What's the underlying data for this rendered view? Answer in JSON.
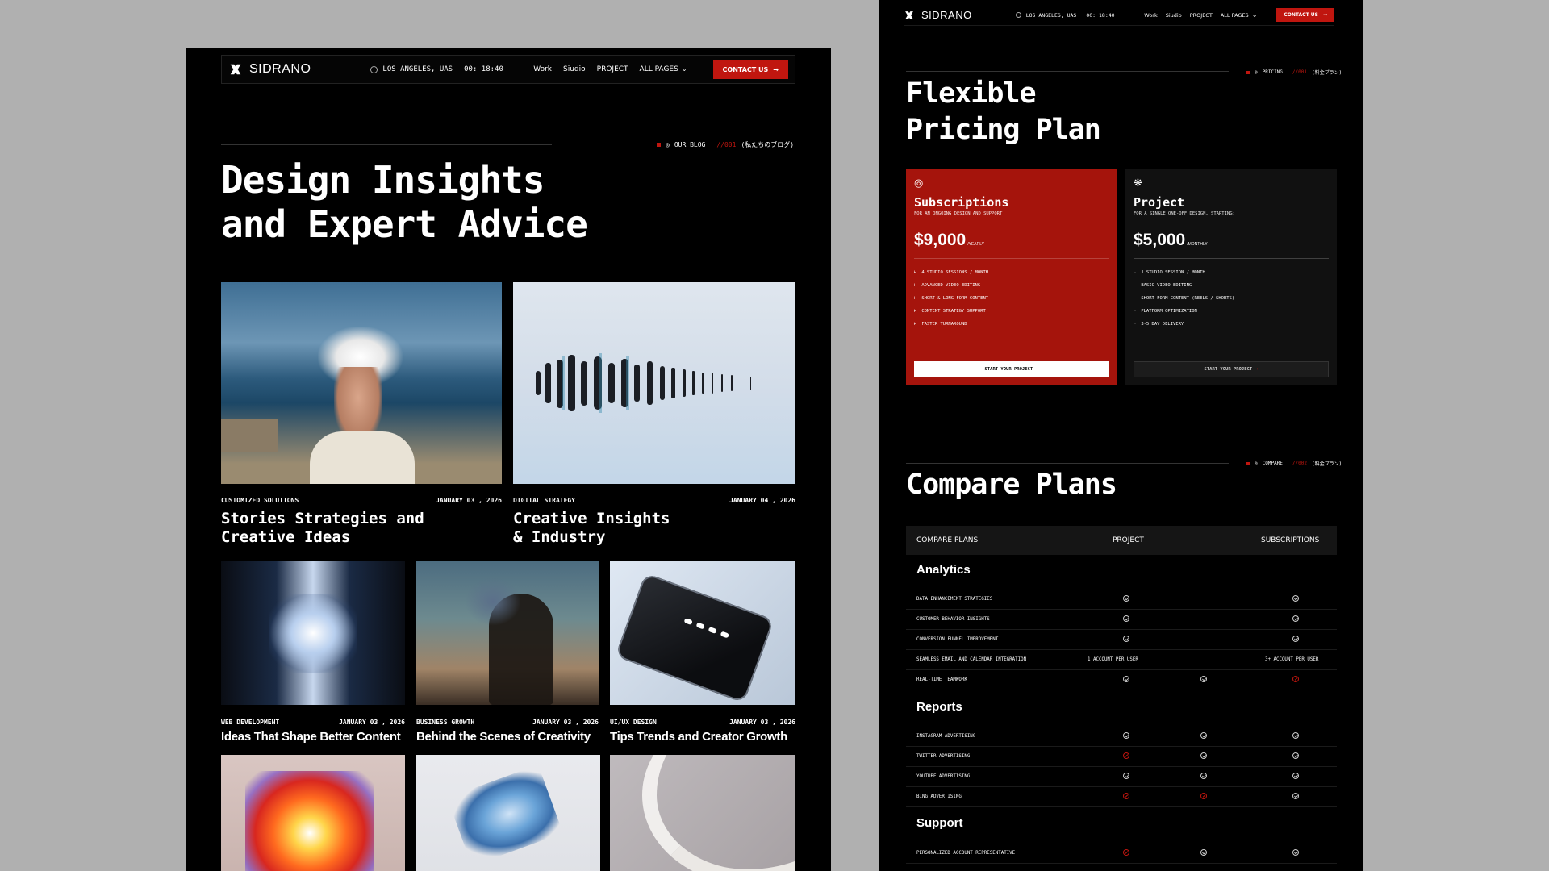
{
  "left": {
    "nav": {
      "brand": "SIDRANO",
      "location": "LOS ANGELES, UAS",
      "time": "00: 18:40",
      "links": [
        "Work",
        "Siudio",
        "PROJECT",
        "ALL PAGES"
      ],
      "cta": "CONTACT US"
    },
    "tag": {
      "label": "OUR BLOG",
      "num": "//001",
      "jp": "(私たちのブログ)"
    },
    "heading_line1": "Design Insights",
    "heading_line2": "and Expert Advice",
    "featured": [
      {
        "category": "CUSTOMIZED SOLUTIONS",
        "date": "JANUARY 03 , 2026",
        "title_line1": "Stories Strategies and",
        "title_line2": "Creative Ideas"
      },
      {
        "category": "DIGITAL STRATEGY",
        "date": "JANUARY 04 , 2026",
        "title_line1": "Creative Insights",
        "title_line2": "& Industry"
      }
    ],
    "posts": [
      {
        "category": "WEB DEVELOPMENT",
        "date": "JANUARY 03 , 2026",
        "title": "Ideas That Shape Better Content"
      },
      {
        "category": "BUSINESS GROWTH",
        "date": "JANUARY 03 , 2026",
        "title": "Behind the Scenes of Creativity"
      },
      {
        "category": "UI/UX DESIGN",
        "date": "JANUARY 03 , 2026",
        "title": "Tips Trends and Creator Growth"
      }
    ]
  },
  "right": {
    "nav": {
      "brand": "SIDRANO",
      "location": "LOS ANGELES, UAS",
      "time": "00: 18:40",
      "links": [
        "Work",
        "Siudio",
        "PROJECT",
        "ALL PAGES"
      ],
      "cta": "CONTACT US"
    },
    "pricing_tag": {
      "label": "PRICING",
      "num": "//001",
      "jp": "(料金プラン)"
    },
    "pricing_heading_line1": "Flexible",
    "pricing_heading_line2": "Pricing Plan",
    "plans": [
      {
        "title": "Subscriptions",
        "subtitle": "FOR AN ONGOING DESIGN AND SUPPORT",
        "price": "$9,000",
        "period": "/YEARLY",
        "features": [
          "4 STUDIO SESSIONS / MONTH",
          "ADVANCED VIDEO EDITING",
          "SHORT & LONG-FORM CONTENT",
          "CONTENT STRATEGY SUPPORT",
          "FASTER TURNAROUND"
        ],
        "button": "START YOUR PROJECT"
      },
      {
        "title": "Project",
        "subtitle": "FOR A SINGLE ONE-OFF DESIGN, STARTING:",
        "price": "$5,000",
        "period": "/MONTHLY",
        "features": [
          "1 STUDIO SESSION / MONTH",
          "BASIC VIDEO EDITING",
          "SHORT-FORM CONTENT (REELS / SHORTS)",
          "PLATFORM OPTIMIZATION",
          "3-5 DAY DELIVERY"
        ],
        "button": "START YOUR PROJECT"
      }
    ],
    "compare_tag": {
      "label": "COMPARE",
      "num": "//002",
      "jp": "(料金プラン)"
    },
    "compare_heading": "Compare Plans",
    "compare_header": {
      "col0": "COMPARE PLANS",
      "col1": "PROJECT",
      "col2": "SUBSCRIPTIONS"
    },
    "groups": {
      "analytics": "Analytics",
      "reports": "Reports",
      "support": "Support"
    },
    "rows": {
      "analytics": [
        {
          "label": "DATA ENHANCEMENT STRATEGIES",
          "c1": "check",
          "c2": "",
          "c3": "check"
        },
        {
          "label": "CUSTOMER BEHAVIOR INSIGHTS",
          "c1": "check",
          "c2": "",
          "c3": "check"
        },
        {
          "label": "CONVERSION FUNNEL IMPROVEMENT",
          "c1": "check",
          "c2": "",
          "c3": "check"
        },
        {
          "label": "SEAMLESS EMAIL AND CALENDAR INTEGRATION",
          "t1": "1 ACCOUNT PER USER",
          "t3": "3+ ACCOUNT PER USER"
        },
        {
          "label": "REAL-TIME TEAMWORK",
          "c1": "check",
          "c2": "check",
          "c3": "cross"
        }
      ],
      "reports": [
        {
          "label": "INSTAGRAM ADVERTISING",
          "c1": "check",
          "c2": "check",
          "c3": "check"
        },
        {
          "label": "TWITTER ADVERTISING",
          "c1": "cross",
          "c2": "check",
          "c3": "check"
        },
        {
          "label": "YOUTUBE ADVERTISING",
          "c1": "check",
          "c2": "check",
          "c3": "check"
        },
        {
          "label": "BING ADVERTISING",
          "c1": "cross",
          "c2": "cross",
          "c3": "check"
        }
      ],
      "support": [
        {
          "label": "PERSONALIZED ACCOUNT REPRESENTATIVE",
          "c1": "cross",
          "c2": "check",
          "c3": "check"
        }
      ]
    }
  }
}
